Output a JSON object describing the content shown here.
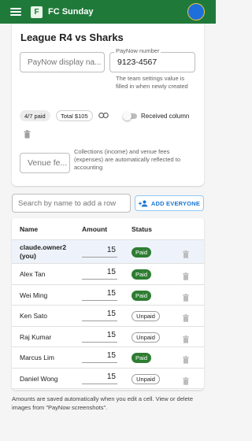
{
  "app": {
    "title": "FC Sunday",
    "logo_letter": "F"
  },
  "match": {
    "title": "League R4 vs Sharks",
    "paynow_display_placeholder": "PayNow display na...",
    "paynow_number_label": "PayNow number",
    "paynow_number_value": "9123-4567",
    "paynow_helper": "The team settings value is filled in when newly created",
    "paid_chip": "4/7 paid",
    "total_chip": "Total $105",
    "received_column_label": "Received column",
    "venue_fee_placeholder": "Venue fe...",
    "venue_helper": "Collections (income) and venue fees (expenses) are automatically reflected to accounting"
  },
  "search": {
    "placeholder": "Search by name to add a row"
  },
  "add_everyone_label": "ADD EVERYONE",
  "table": {
    "headers": {
      "name": "Name",
      "amount": "Amount",
      "status": "Status"
    },
    "rows": [
      {
        "name": "claude.owner2 (you)",
        "amount": "15",
        "status": "Paid"
      },
      {
        "name": "Alex Tan",
        "amount": "15",
        "status": "Paid"
      },
      {
        "name": "Wei Ming",
        "amount": "15",
        "status": "Paid"
      },
      {
        "name": "Ken Sato",
        "amount": "15",
        "status": "Unpaid"
      },
      {
        "name": "Raj Kumar",
        "amount": "15",
        "status": "Unpaid"
      },
      {
        "name": "Marcus Lim",
        "amount": "15",
        "status": "Paid"
      },
      {
        "name": "Daniel Wong",
        "amount": "15",
        "status": "Unpaid"
      }
    ]
  },
  "footer_note": "Amounts are saved automatically when you edit a cell. View or delete images from \"PayNow screenshots\".",
  "icons": {
    "menu": "menu-icon",
    "link": "link-icon",
    "trash": "trash-icon",
    "add_person": "person-add-icon"
  },
  "colors": {
    "appbar": "#1f7a3a",
    "accent_line": "#f2c230",
    "paid": "#2e7d32",
    "primary": "#1976d2",
    "avatar": "#1e6fd9"
  }
}
